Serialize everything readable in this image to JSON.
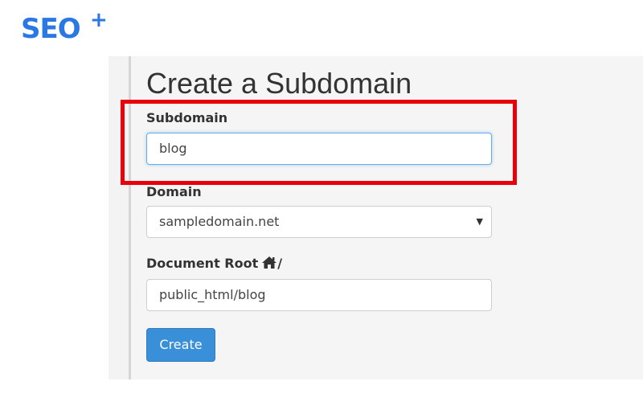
{
  "logo": {
    "text": "SEO",
    "superscript": "+"
  },
  "page": {
    "title": "Create a Subdomain"
  },
  "form": {
    "subdomain": {
      "label": "Subdomain",
      "value": "blog"
    },
    "domain": {
      "label": "Domain",
      "selected": "sampledomain.net"
    },
    "document_root": {
      "label": "Document Root",
      "path_suffix": "/",
      "value": "public_html/blog"
    },
    "create_label": "Create"
  },
  "icons": {
    "home": "home-icon",
    "dropdown": "caret-down-icon"
  },
  "colors": {
    "brand": "#2b78e4",
    "button": "#3a8fd9",
    "highlight": "#e8000b",
    "focus": "#66afe9"
  }
}
